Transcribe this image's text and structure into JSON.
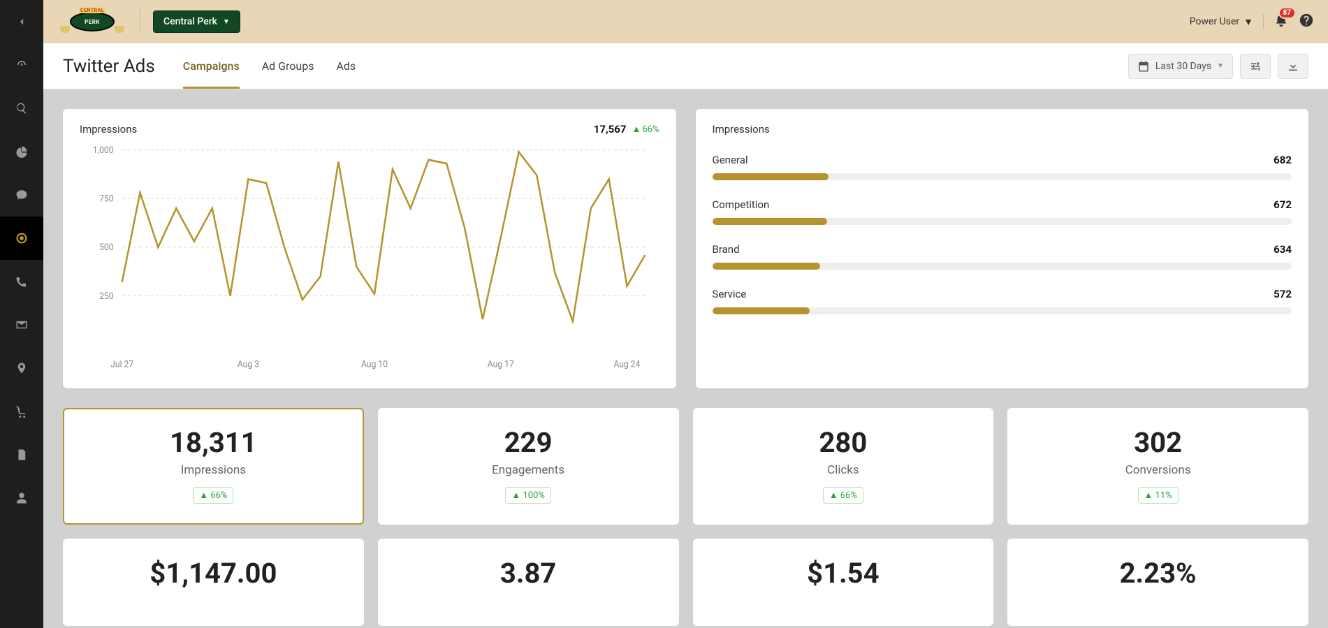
{
  "brand_dropdown": {
    "label": "Central Perk"
  },
  "user": {
    "label": "Power User"
  },
  "notifications": {
    "count": "87"
  },
  "page": {
    "title": "Twitter Ads"
  },
  "tabs": [
    "Campaigns",
    "Ad Groups",
    "Ads"
  ],
  "date_range": {
    "label": "Last 30 Days"
  },
  "chart": {
    "label": "Impressions",
    "total": "17,567",
    "delta": "66%"
  },
  "bars": {
    "title": "Impressions",
    "max": 700,
    "items": [
      {
        "label": "General",
        "value": 682
      },
      {
        "label": "Competition",
        "value": 672
      },
      {
        "label": "Brand",
        "value": 634
      },
      {
        "label": "Service",
        "value": 572
      }
    ]
  },
  "kpis": [
    {
      "value": "18,311",
      "label": "Impressions",
      "delta": "66%",
      "selected": true
    },
    {
      "value": "229",
      "label": "Engagements",
      "delta": "100%"
    },
    {
      "value": "280",
      "label": "Clicks",
      "delta": "66%"
    },
    {
      "value": "302",
      "label": "Conversions",
      "delta": "11%"
    }
  ],
  "kpis2": [
    {
      "value": "$1,147.00"
    },
    {
      "value": "3.87"
    },
    {
      "value": "$1.54"
    },
    {
      "value": "2.23%"
    }
  ],
  "chart_data": {
    "type": "line",
    "title": "Impressions",
    "xlabel": "",
    "ylabel": "",
    "ylim": [
      0,
      1000
    ],
    "yticks": [
      250,
      500,
      750,
      1000
    ],
    "x_categories": [
      "Jul 27",
      "Jul 28",
      "Jul 29",
      "Jul 30",
      "Jul 31",
      "Aug 1",
      "Aug 2",
      "Aug 3",
      "Aug 4",
      "Aug 5",
      "Aug 6",
      "Aug 7",
      "Aug 8",
      "Aug 9",
      "Aug 10",
      "Aug 11",
      "Aug 12",
      "Aug 13",
      "Aug 14",
      "Aug 15",
      "Aug 16",
      "Aug 17",
      "Aug 18",
      "Aug 19",
      "Aug 20",
      "Aug 21",
      "Aug 22",
      "Aug 23",
      "Aug 24",
      "Aug 25"
    ],
    "x_tick_labels": [
      "Jul 27",
      "Aug 3",
      "Aug 10",
      "Aug 17",
      "Aug 24"
    ],
    "series": [
      {
        "name": "Impressions",
        "values": [
          320,
          780,
          500,
          700,
          530,
          700,
          250,
          850,
          830,
          500,
          230,
          350,
          940,
          400,
          260,
          900,
          700,
          950,
          930,
          600,
          130,
          550,
          990,
          870,
          370,
          120,
          700,
          850,
          300,
          460
        ]
      }
    ]
  }
}
